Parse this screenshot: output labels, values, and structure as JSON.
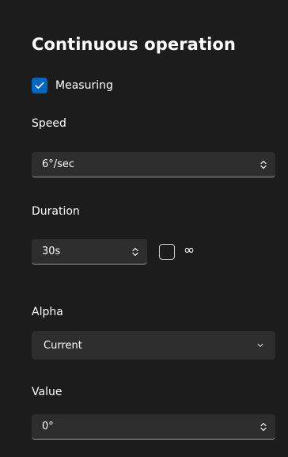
{
  "panel": {
    "title": "Continuous operation"
  },
  "measuring": {
    "label": "Measuring",
    "checked": true,
    "icon": "checkmark-icon",
    "accent_color": "#0067c0"
  },
  "speed": {
    "label": "Speed",
    "value": "6°/sec",
    "icon": "spinner-chevrons-icon"
  },
  "duration": {
    "label": "Duration",
    "value": "30s",
    "icon": "spinner-chevrons-icon",
    "infinite_checked": false,
    "infinite_symbol": "∞"
  },
  "alpha": {
    "label": "Alpha",
    "selected": "Current",
    "icon": "chevron-down-icon"
  },
  "value": {
    "label": "Value",
    "value": "0°",
    "icon": "spinner-chevrons-icon"
  }
}
